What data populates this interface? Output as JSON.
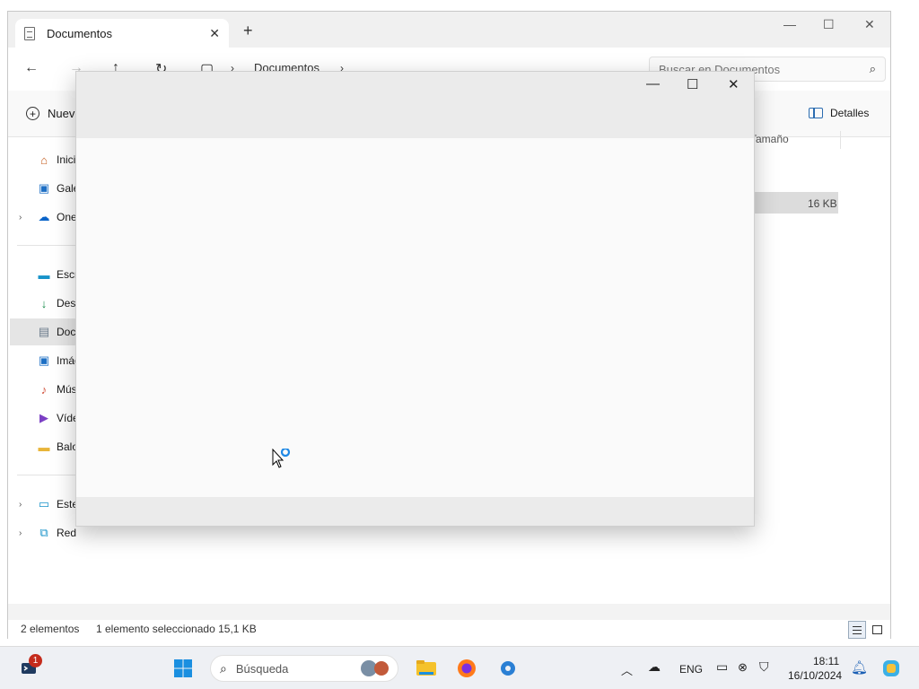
{
  "explorer": {
    "tab_title": "Documentos",
    "tab_close": "✕",
    "new_tab": "+",
    "breadcrumb": "Documentos",
    "search_placeholder": "Buscar en Documentos",
    "new_label": "Nuevo",
    "details_label": "Detalles",
    "column_size": "Tamaño",
    "selected_file_size": "16 KB",
    "status_items": "2 elementos",
    "status_selection": "1 elemento seleccionado  15,1 KB",
    "sidebar": [
      {
        "label": "Inicio",
        "icon": "home-icon"
      },
      {
        "label": "Galería",
        "icon": "gallery-icon"
      },
      {
        "label": "OneDrive",
        "icon": "onedrive-icon"
      },
      {
        "label": "Escritorio",
        "icon": "desktop-icon"
      },
      {
        "label": "Descargas",
        "icon": "download-icon"
      },
      {
        "label": "Documentos",
        "icon": "documents-icon"
      },
      {
        "label": "Imágenes",
        "icon": "pictures-icon"
      },
      {
        "label": "Música",
        "icon": "music-icon"
      },
      {
        "label": "Vídeos",
        "icon": "videos-icon"
      },
      {
        "label": "Baloncesto",
        "icon": "folder-icon"
      },
      {
        "label": "Este equipo",
        "icon": "this-pc-icon"
      },
      {
        "label": "Red",
        "icon": "network-icon"
      }
    ]
  },
  "taskbar": {
    "search_placeholder": "Búsqueda",
    "notification_count": "1",
    "language": "ENG",
    "time": "18:11",
    "date": "16/10/2024"
  },
  "colors": {
    "accent": "#0067c0",
    "badge": "#c42b1c",
    "taskbar_bg": "#eef0f4"
  }
}
